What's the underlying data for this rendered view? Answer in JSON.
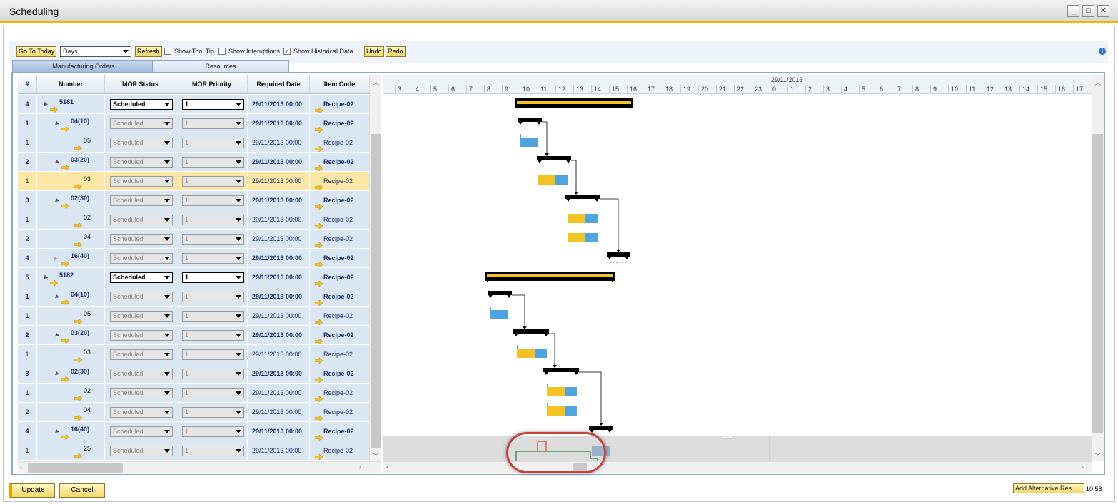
{
  "window": {
    "title": "Scheduling",
    "buttons": [
      "_",
      "□",
      "✕"
    ]
  },
  "toolbar": {
    "go_to_today": "Go To Today",
    "view_select": "Days",
    "refresh": "Refresh",
    "show_tool_tip": "Show Tool Tip",
    "show_tool_tip_checked": false,
    "show_interuptions": "Show Interuptions",
    "show_interuptions_checked": false,
    "show_historical_data": "Show Historical Data",
    "show_historical_data_checked": true,
    "undo": "Undo",
    "redo": "Redo",
    "info_icon": "i"
  },
  "tabs": [
    {
      "label": "Manufacturing Orders",
      "active": true
    },
    {
      "label": "Resources",
      "active": false
    }
  ],
  "grid": {
    "columns": [
      "#",
      "Number",
      "MOR Status",
      "MOR Priority",
      "Required Date",
      "Item Code"
    ],
    "rows": [
      {
        "num": "4",
        "number": "5181",
        "level": 0,
        "expander": "open",
        "status": "Scheduled",
        "priority": "1",
        "date": "29/11/2013 00:00",
        "item": "Recipe-02",
        "bold": true,
        "active": true
      },
      {
        "num": "1",
        "number": "04(10)",
        "level": 1,
        "expander": "open",
        "status": "Scheduled",
        "priority": "1",
        "date": "29/11/2013 00:00",
        "item": "Recipe-02",
        "bold": true,
        "active": false
      },
      {
        "num": "1",
        "number": "05",
        "level": 2,
        "expander": "none",
        "status": "Scheduled",
        "priority": "1",
        "date": "29/11/2013 00:00",
        "item": "Recipe-02",
        "bold": false,
        "active": false
      },
      {
        "num": "2",
        "number": "03(20)",
        "level": 1,
        "expander": "open",
        "status": "Scheduled",
        "priority": "1",
        "date": "29/11/2013 00:00",
        "item": "Recipe-02",
        "bold": true,
        "active": false
      },
      {
        "num": "1",
        "number": "03",
        "level": 2,
        "expander": "none",
        "status": "Scheduled",
        "priority": "1",
        "date": "29/11/2013 00:00",
        "item": "Recipe-02",
        "bold": false,
        "active": false,
        "selected": true
      },
      {
        "num": "3",
        "number": "02(30)",
        "level": 1,
        "expander": "open",
        "status": "Scheduled",
        "priority": "1",
        "date": "29/11/2013 00:00",
        "item": "Recipe-02",
        "bold": true,
        "active": false
      },
      {
        "num": "1",
        "number": "02",
        "level": 2,
        "expander": "none",
        "status": "Scheduled",
        "priority": "1",
        "date": "29/11/2013 00:00",
        "item": "Recipe-02",
        "bold": false,
        "active": false
      },
      {
        "num": "2",
        "number": "04",
        "level": 2,
        "expander": "none",
        "status": "Scheduled",
        "priority": "1",
        "date": "29/11/2013 00:00",
        "item": "Recipe-02",
        "bold": false,
        "active": false
      },
      {
        "num": "4",
        "number": "16(40)",
        "level": 1,
        "expander": "closed",
        "status": "Scheduled",
        "priority": "1",
        "date": "29/11/2013 00:00",
        "item": "Recipe-02",
        "bold": true,
        "active": false
      },
      {
        "num": "5",
        "number": "5182",
        "level": 0,
        "expander": "open",
        "status": "Scheduled",
        "priority": "1",
        "date": "29/11/2013 00:00",
        "item": "Recipe-02",
        "bold": true,
        "active": true
      },
      {
        "num": "1",
        "number": "04(10)",
        "level": 1,
        "expander": "open",
        "status": "Scheduled",
        "priority": "1",
        "date": "29/11/2013 00:00",
        "item": "Recipe-02",
        "bold": true,
        "active": false
      },
      {
        "num": "1",
        "number": "05",
        "level": 2,
        "expander": "none",
        "status": "Scheduled",
        "priority": "1",
        "date": "29/11/2013 00:00",
        "item": "Recipe-02",
        "bold": false,
        "active": false
      },
      {
        "num": "2",
        "number": "03(20)",
        "level": 1,
        "expander": "open",
        "status": "Scheduled",
        "priority": "1",
        "date": "29/11/2013 00:00",
        "item": "Recipe-02",
        "bold": true,
        "active": false
      },
      {
        "num": "1",
        "number": "03",
        "level": 2,
        "expander": "none",
        "status": "Scheduled",
        "priority": "1",
        "date": "29/11/2013 00:00",
        "item": "Recipe-02",
        "bold": false,
        "active": false
      },
      {
        "num": "3",
        "number": "02(30)",
        "level": 1,
        "expander": "open",
        "status": "Scheduled",
        "priority": "1",
        "date": "29/11/2013 00:00",
        "item": "Recipe-02",
        "bold": true,
        "active": false
      },
      {
        "num": "1",
        "number": "02",
        "level": 2,
        "expander": "none",
        "status": "Scheduled",
        "priority": "1",
        "date": "29/11/2013 00:00",
        "item": "Recipe-02",
        "bold": false,
        "active": false
      },
      {
        "num": "2",
        "number": "04",
        "level": 2,
        "expander": "none",
        "status": "Scheduled",
        "priority": "1",
        "date": "29/11/2013 00:00",
        "item": "Recipe-02",
        "bold": false,
        "active": false
      },
      {
        "num": "4",
        "number": "16(40)",
        "level": 1,
        "expander": "open",
        "status": "Scheduled",
        "priority": "1",
        "date": "29/11/2013 00:00",
        "item": "Recipe-02",
        "bold": true,
        "active": false
      },
      {
        "num": "1",
        "number": "25",
        "level": 2,
        "expander": "none",
        "status": "Scheduled",
        "priority": "1",
        "date": "29/11/2013 00:00",
        "item": "Recipe-02",
        "bold": false,
        "active": false
      }
    ]
  },
  "gantt": {
    "date_label": "29/11/2013",
    "hours_day1": [
      "3",
      "4",
      "5",
      "6",
      "7",
      "8",
      "9",
      "10",
      "11",
      "12",
      "13",
      "14",
      "15",
      "16",
      "17",
      "18",
      "19",
      "20",
      "21",
      "22",
      "23"
    ],
    "hours_day2": [
      "0",
      "1",
      "2",
      "3",
      "4",
      "5",
      "6",
      "7",
      "8",
      "9",
      "10",
      "11",
      "12",
      "13",
      "14",
      "15",
      "16",
      "17"
    ]
  },
  "footer": {
    "update": "Update",
    "cancel": "Cancel",
    "add_alternative": "Add Alternative Res...",
    "clock": "10:58"
  },
  "colors": {
    "accent": "#f2b500",
    "bar_yellow": "#f5c226",
    "bar_blue": "#4fa3de",
    "row_bg": "#dbe6f3",
    "row_selected": "#fde7a6",
    "highlight": "#c4433a"
  }
}
